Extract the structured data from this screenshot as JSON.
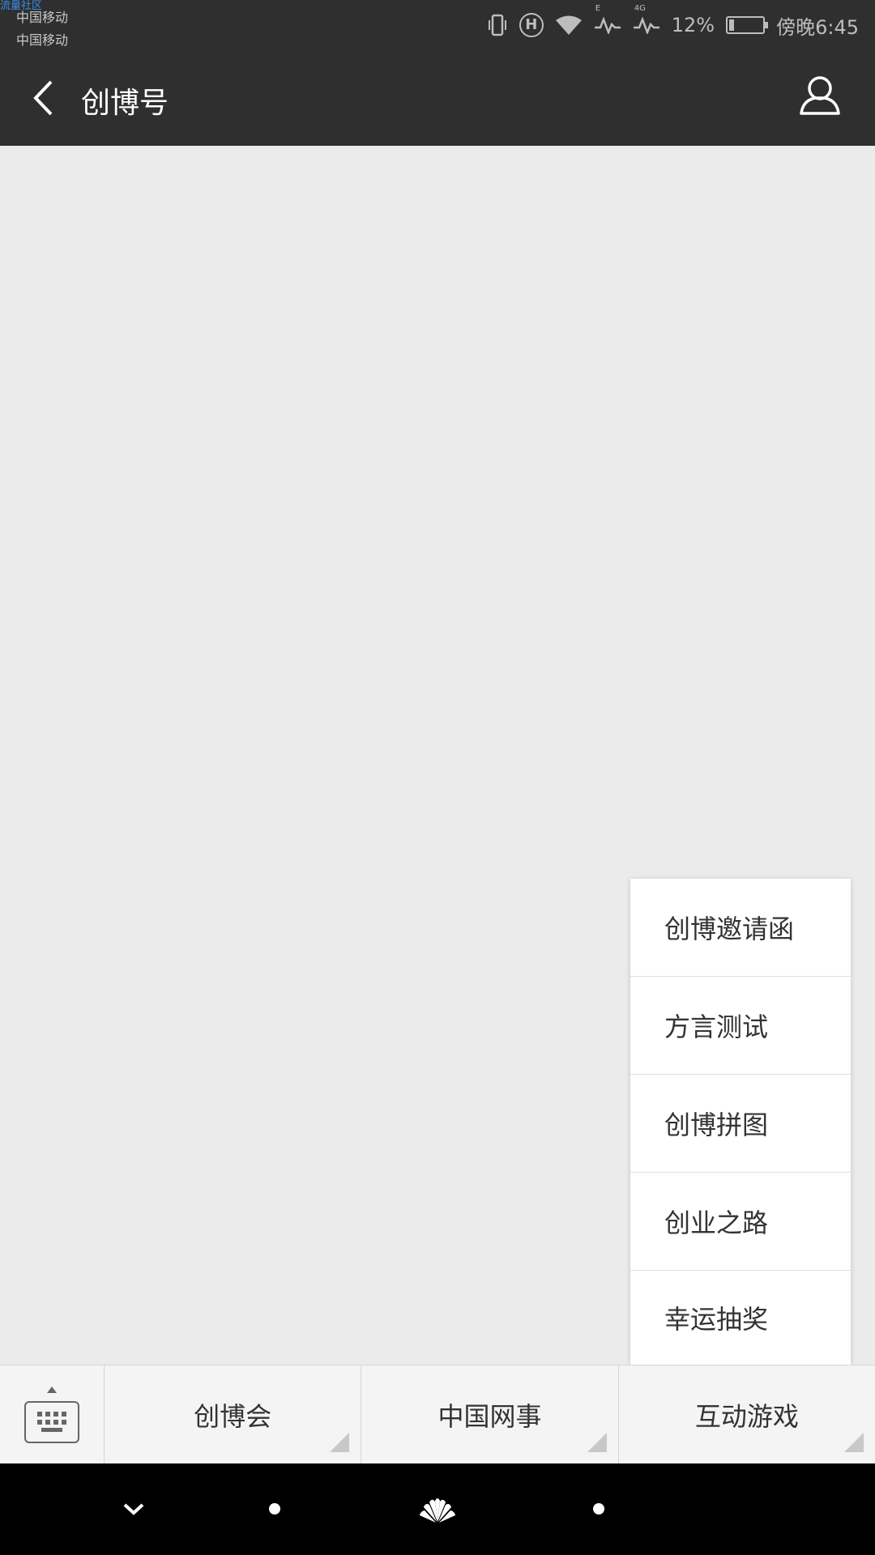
{
  "status_bar": {
    "watermark": "流量社区",
    "carrier_1": "中国移动",
    "carrier_2": "中国移动",
    "signal_1_tag": "E",
    "signal_2_tag": "4G",
    "battery_percent": "12%",
    "time": "傍晚6:45",
    "icons": [
      "vibrate-icon",
      "hd-icon",
      "wifi-icon",
      "signal-icon",
      "signal-icon",
      "battery-icon"
    ]
  },
  "nav": {
    "title": "创博号",
    "hd_label": "H"
  },
  "popup_menu": {
    "items": [
      "创博邀请函",
      "方言测试",
      "创博拼图",
      "创业之路",
      "幸运抽奖"
    ]
  },
  "bottom_menu": {
    "tabs": [
      "创博会",
      "中国网事",
      "互动游戏"
    ]
  },
  "colors": {
    "header_bg": "#2f2f2f",
    "content_bg": "#ebebeb",
    "menu_bg": "#f4f4f4",
    "system_nav_bg": "#000000"
  }
}
